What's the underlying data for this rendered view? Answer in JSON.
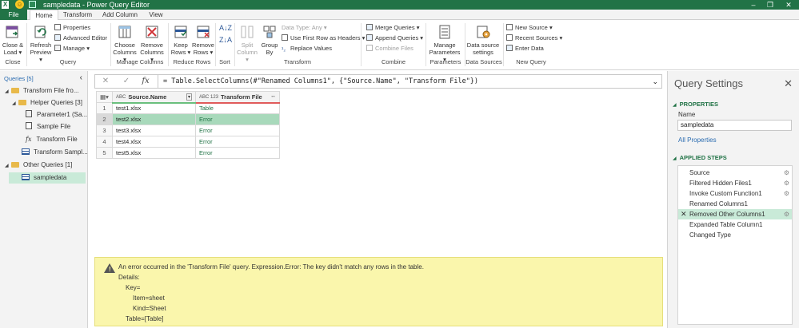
{
  "app": {
    "title": "sampledata - Power Query Editor"
  },
  "tabs": [
    "File",
    "Home",
    "Transform",
    "Add Column",
    "View"
  ],
  "ribbon": {
    "close_load": [
      "Close &",
      "Load"
    ],
    "refresh": [
      "Refresh",
      "Preview"
    ],
    "properties": "Properties",
    "advanced_editor": "Advanced Editor",
    "manage": "Manage",
    "choose_columns": [
      "Choose",
      "Columns"
    ],
    "remove_columns": [
      "Remove",
      "Columns"
    ],
    "keep_rows": [
      "Keep",
      "Rows"
    ],
    "remove_rows": [
      "Remove",
      "Rows"
    ],
    "split_column": [
      "Split",
      "Column"
    ],
    "group_by": [
      "Group",
      "By"
    ],
    "data_type": "Data Type: Any",
    "use_first_row": "Use First Row as Headers",
    "replace_values": "Replace Values",
    "merge_queries": "Merge Queries",
    "append_queries": "Append Queries",
    "combine_files": "Combine Files",
    "manage_parameters": [
      "Manage",
      "Parameters"
    ],
    "data_source_settings": [
      "Data source",
      "settings"
    ],
    "new_source": "New Source",
    "recent_sources": "Recent Sources",
    "enter_data": "Enter Data",
    "groups": {
      "close": "Close",
      "query": "Query",
      "manage_columns": "Manage Columns",
      "reduce_rows": "Reduce Rows",
      "sort": "Sort",
      "transform": "Transform",
      "combine": "Combine",
      "parameters": "Parameters",
      "data_sources": "Data Sources",
      "new_query": "New Query"
    }
  },
  "queries": {
    "header": "Queries [5]",
    "tree": {
      "transform_folder": "Transform File fro...",
      "helper_folder": "Helper Queries [3]",
      "parameter1": "Parameter1 (Sa...",
      "sample_file": "Sample File",
      "transform_file": "Transform File",
      "transform_sample": "Transform Sampl...",
      "other_folder": "Other Queries [1]",
      "sampledata": "sampledata"
    }
  },
  "formula": {
    "text": "= Table.SelectColumns(#\"Renamed Columns1\", {\"Source.Name\", \"Transform File\"})",
    "fx": "fx"
  },
  "table": {
    "columns": [
      "Source.Name",
      "Transform File"
    ],
    "type_labels": [
      "ABC",
      "ABC 123"
    ],
    "rows": [
      {
        "n": "1",
        "name": "test1.xlsx",
        "value": "Table"
      },
      {
        "n": "2",
        "name": "test2.xlsx",
        "value": "Error"
      },
      {
        "n": "3",
        "name": "test3.xlsx",
        "value": "Error"
      },
      {
        "n": "4",
        "name": "test4.xlsx",
        "value": "Error"
      },
      {
        "n": "5",
        "name": "test5.xlsx",
        "value": "Error"
      }
    ]
  },
  "error": {
    "message": "An error occurred in the 'Transform File' query. Expression.Error: The key didn't match any rows in the table.",
    "details": "Details:",
    "key": "Key=",
    "item": "Item=sheet",
    "kind": "Kind=Sheet",
    "table": "Table=[Table]"
  },
  "settings": {
    "title": "Query Settings",
    "properties": "PROPERTIES",
    "name_label": "Name",
    "name_value": "sampledata",
    "all_properties": "All Properties",
    "applied_steps": "APPLIED STEPS",
    "steps": [
      {
        "label": "Source",
        "gear": true
      },
      {
        "label": "Filtered Hidden Files1",
        "gear": true
      },
      {
        "label": "Invoke Custom Function1",
        "gear": true
      },
      {
        "label": "Renamed Columns1",
        "gear": false
      },
      {
        "label": "Removed Other Columns1",
        "gear": true,
        "active": true
      },
      {
        "label": "Expanded Table Column1",
        "gear": false
      },
      {
        "label": "Changed Type",
        "gear": false
      }
    ]
  }
}
